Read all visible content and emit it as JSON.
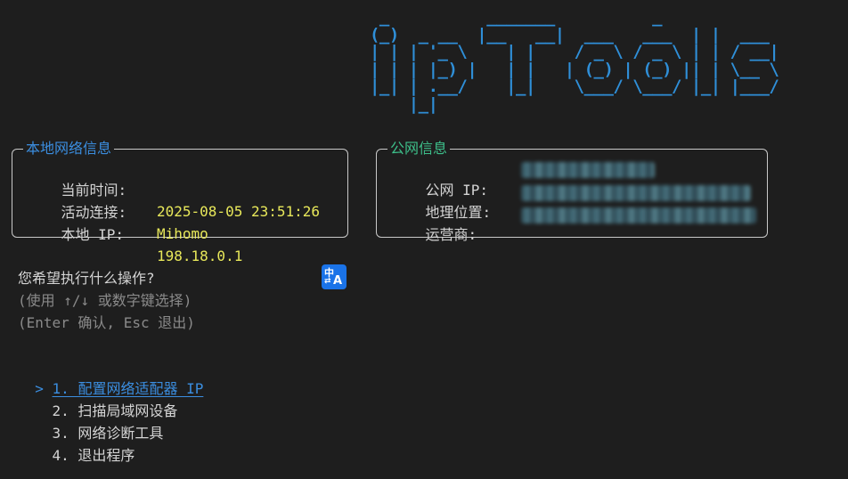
{
  "banner": {
    "text": "  _          _______          _\n (_)  _ __  |__   __|  ___   ___  | |  ___\n | | | '_ \\    | |    / _ \\ / _ \\ | | / __|\n | | | |_) |   | |   | (_) | (_) || | \\__ \\\n |_| | .__/    |_|    \\___/ \\___/ |_| |___/\n     |_|",
    "color": "#2f8fd8"
  },
  "local_panel": {
    "title": "本地网络信息",
    "title_color": "#3b8ee0",
    "rows": [
      {
        "label": "当前时间:",
        "value": "2025-08-05 23:51:26"
      },
      {
        "label": "活动连接:",
        "value": "Mihomo"
      },
      {
        "label": "本地 IP:",
        "value": "198.18.0.1"
      }
    ]
  },
  "public_panel": {
    "title": "公网信息",
    "title_color": "#3dbf8a",
    "rows": [
      {
        "label": "公网 IP:"
      },
      {
        "label": "地理位置:"
      },
      {
        "label": "运营商:"
      }
    ]
  },
  "prompt": {
    "question": "您希望执行什么操作?",
    "hint1": "(使用 ↑/↓ 或数字键选择)",
    "hint2": "(Enter 确认, Esc 退出)"
  },
  "menu": {
    "pointer": ">",
    "items": [
      {
        "label": "1. 配置网络适配器 IP"
      },
      {
        "label": "2. 扫描局域网设备"
      },
      {
        "label": "3. 网络诊断工具"
      },
      {
        "label": "4. 退出程序"
      }
    ]
  },
  "translate_icon": {
    "zh": "中",
    "a": "A",
    "arrows": "⇄",
    "color": "#1a73e8"
  }
}
